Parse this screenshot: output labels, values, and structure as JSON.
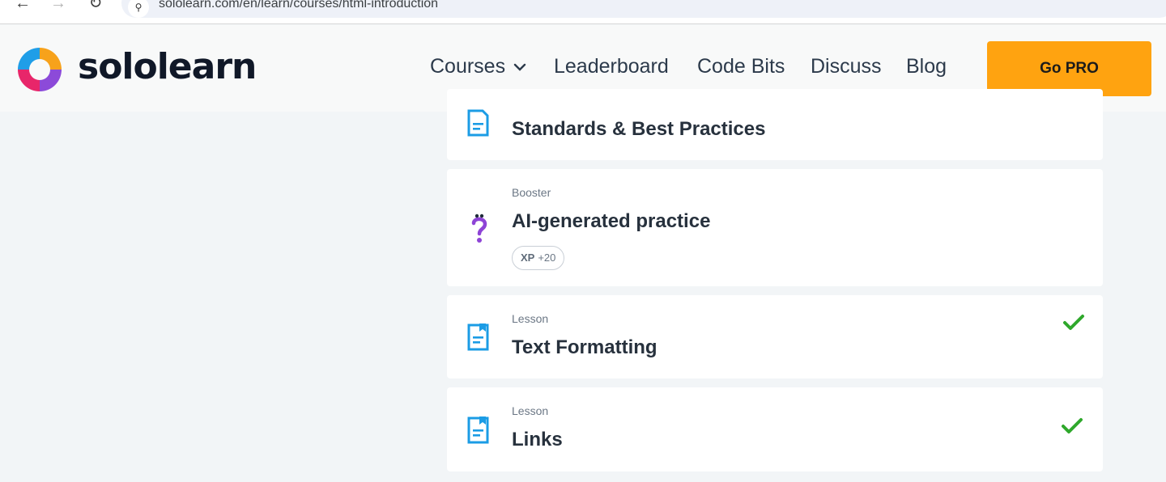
{
  "browser": {
    "url": "sololearn.com/en/learn/courses/html-introduction"
  },
  "header": {
    "logo_text": "sololearn",
    "nav": [
      {
        "label": "Courses"
      },
      {
        "label": "Leaderboard"
      },
      {
        "label": "Code Bits"
      },
      {
        "label": "Discuss"
      },
      {
        "label": "Blog"
      }
    ],
    "cta_label": "Go PRO"
  },
  "colors": {
    "accent_cta": "#ffa310",
    "lesson_icon": "#1b9ce5",
    "check": "#2fa82c",
    "booster_icon": "#8e44d6"
  },
  "cards": [
    {
      "type": "",
      "title": "Standards & Best Practices",
      "icon": "lesson-icon",
      "completed": false
    },
    {
      "type": "Booster",
      "title": "AI-generated practice",
      "icon": "question-mark-icon",
      "xp_label": "XP",
      "xp_value": "+20",
      "completed": false
    },
    {
      "type": "Lesson",
      "title": "Text Formatting",
      "icon": "lesson-icon",
      "completed": true
    },
    {
      "type": "Lesson",
      "title": "Links",
      "icon": "lesson-icon",
      "completed": true
    }
  ]
}
